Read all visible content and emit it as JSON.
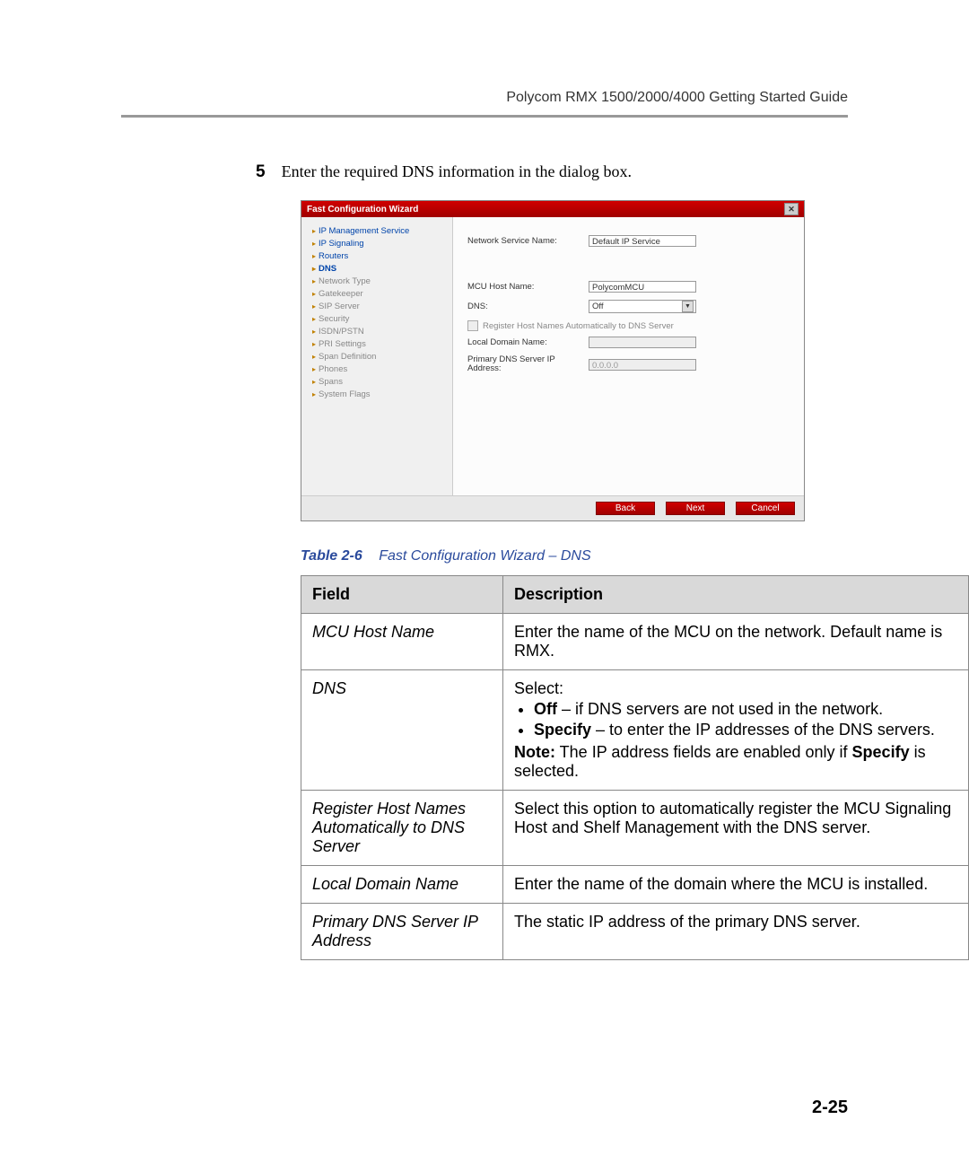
{
  "header": "Polycom RMX 1500/2000/4000 Getting Started Guide",
  "step": {
    "num": "5",
    "text": "Enter the required DNS information in the dialog box."
  },
  "dialog": {
    "title": "Fast Configuration Wizard",
    "sidebar": [
      "IP Management Service",
      "IP Signaling",
      "Routers",
      "DNS",
      "Network Type",
      "Gatekeeper",
      "SIP Server",
      "Security",
      "ISDN/PSTN",
      "PRI Settings",
      "Span Definition",
      "Phones",
      "Spans",
      "System Flags"
    ],
    "form": {
      "network_service_label": "Network Service Name:",
      "network_service_value": "Default IP Service",
      "mcu_host_label": "MCU Host Name:",
      "mcu_host_value": "PolycomMCU",
      "dns_label": "DNS:",
      "dns_value": "Off",
      "register_label": "Register Host Names Automatically to DNS Server",
      "local_domain_label": "Local Domain Name:",
      "local_domain_value": "",
      "primary_dns_label": "Primary DNS Server IP Address:",
      "primary_dns_value": "0.0.0.0"
    },
    "buttons": {
      "back": "Back",
      "next": "Next",
      "cancel": "Cancel"
    }
  },
  "table_caption": {
    "label": "Table 2-6",
    "text": "Fast Configuration Wizard – DNS"
  },
  "table": {
    "headers": {
      "field": "Field",
      "description": "Description"
    },
    "rows": [
      {
        "field": "MCU Host Name",
        "descHtml": "Enter the name of the MCU on the network. Default name is RMX."
      },
      {
        "field": "DNS",
        "descHtml": "Select:<ul><li><b>Off</b> – if DNS servers are not used in the network.</li><li><b>Specify</b> – to enter the IP addresses of the DNS servers.</li></ul><b>Note:</b> The IP address fields are enabled only if <b>Specify</b> is selected."
      },
      {
        "field": "Register Host Names Automatically to DNS Server",
        "descHtml": "Select this option to automatically register the MCU Signaling Host and Shelf Management with the DNS server."
      },
      {
        "field": "Local Domain Name",
        "descHtml": "Enter the name of the domain where the MCU is installed."
      },
      {
        "field": "Primary DNS Server IP Address",
        "descHtml": "The static IP address of the primary DNS server."
      }
    ]
  },
  "page_number": "2-25"
}
